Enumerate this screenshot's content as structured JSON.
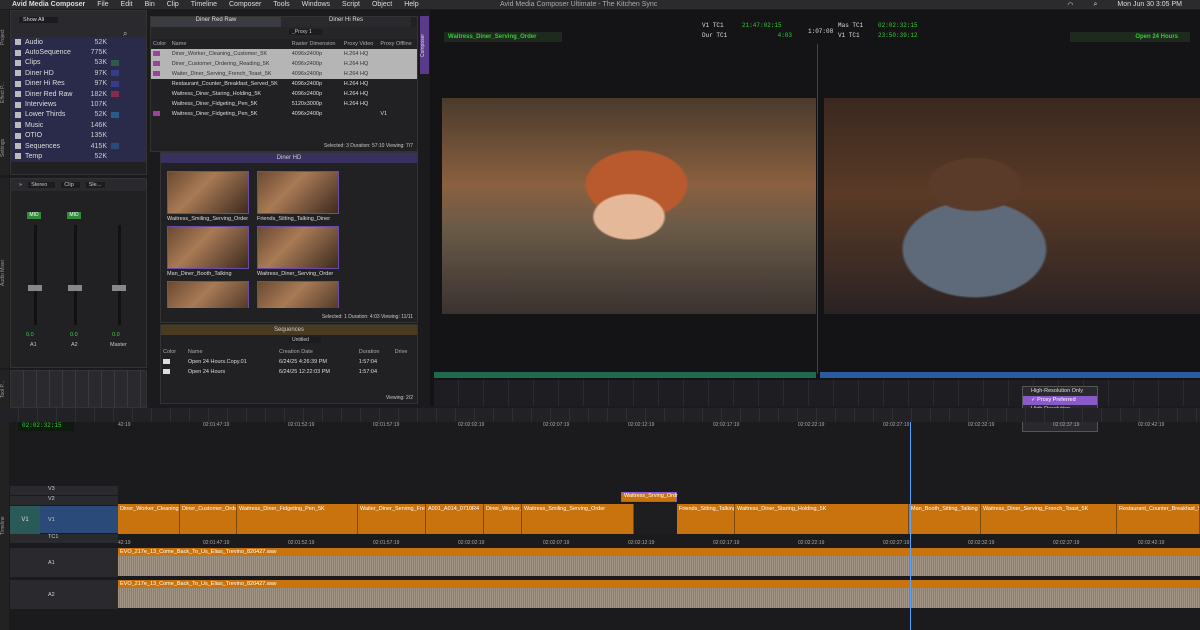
{
  "menubar": {
    "app": "Avid Media Composer",
    "items": [
      "File",
      "Edit",
      "Bin",
      "Clip",
      "Timeline",
      "Composer",
      "Tools",
      "Windows",
      "Script",
      "Object",
      "Help"
    ],
    "window_title": "Avid Media Composer Ultimate - The Kitchen Sync",
    "clock": "Mon Jun 30  3:05 PM"
  },
  "project": {
    "filter": "Show All",
    "bins": [
      {
        "name": "Audio",
        "size": "52K",
        "color": ""
      },
      {
        "name": "AutoSequence",
        "size": "775K",
        "color": ""
      },
      {
        "name": "Clips",
        "size": "53K",
        "color": "#2e5a4a"
      },
      {
        "name": "Diner HD",
        "size": "97K",
        "color": "#3a3a8a"
      },
      {
        "name": "Diner Hi Res",
        "size": "97K",
        "color": "#3a3a8a"
      },
      {
        "name": "Diner Red Raw",
        "size": "182K",
        "color": "#8a2a4a"
      },
      {
        "name": "Interviews",
        "size": "107K",
        "color": ""
      },
      {
        "name": "Lower Thirds",
        "size": "52K",
        "color": "#2a5a8a"
      },
      {
        "name": "Music",
        "size": "146K",
        "color": ""
      },
      {
        "name": "OTIO",
        "size": "135K",
        "color": ""
      },
      {
        "name": "Sequences",
        "size": "415K",
        "color": "#2a4a7a"
      },
      {
        "name": "Temp",
        "size": "52K",
        "color": ""
      }
    ],
    "side_tabs": [
      "Project",
      "Effect P...",
      "Settings"
    ]
  },
  "mixer": {
    "side_tab": "Audio Mixer",
    "selectors": [
      "Stereo",
      "Clip",
      "Sle..."
    ],
    "channels": [
      {
        "name": "A1",
        "mode": "MID",
        "value": "0.0"
      },
      {
        "name": "A2",
        "mode": "MID",
        "value": "0.0"
      },
      {
        "name": "Master",
        "mode": "",
        "value": "0.0"
      }
    ],
    "scale": [
      "+12",
      "+9",
      "+6",
      "+3",
      "0",
      "-3",
      "-6",
      "-9",
      "-12",
      "-15",
      "-20",
      "-30",
      "-40",
      "-50",
      "-60"
    ]
  },
  "tool_palette_tab": "Tool P...",
  "bin_red_raw": {
    "tabs": [
      "Diner Red Raw",
      "Diner Hi Res"
    ],
    "proxy_select": "_Proxy 1",
    "columns": [
      "Color",
      "Name",
      "Raster Dimension",
      "Proxy Video",
      "Proxy Offline"
    ],
    "rows": [
      {
        "name": "Diner_Worker_Cleaning_Customer_5K",
        "raster": "4096x2400p",
        "proxy": "H.264 HQ",
        "offline": "",
        "color": "#a0409a",
        "selected": true
      },
      {
        "name": "Diner_Customer_Ordering_Reading_5K",
        "raster": "4096x2400p",
        "proxy": "H.264 HQ",
        "offline": "",
        "color": "#a0409a",
        "selected": true
      },
      {
        "name": "Waiter_Diner_Serving_French_Toast_5K",
        "raster": "4096x2400p",
        "proxy": "H.264 HQ",
        "offline": "",
        "color": "#a0409a",
        "selected": true
      },
      {
        "name": "Restaurant_Counter_Breakfast_Served_5K",
        "raster": "4096x2400p",
        "proxy": "H.264 HQ",
        "offline": "",
        "color": "",
        "selected": false
      },
      {
        "name": "Waitress_Diner_Staring_Holding_5K",
        "raster": "4096x2400p",
        "proxy": "H.264 HQ",
        "offline": "",
        "color": "",
        "selected": false
      },
      {
        "name": "Waitress_Diner_Fidgeting_Pen_5K",
        "raster": "5120x3000p",
        "proxy": "H.264 HQ",
        "offline": "",
        "color": "",
        "selected": false
      },
      {
        "name": "Waitress_Diner_Fidgeting_Pen_5K",
        "raster": "4096x2400p",
        "proxy": "",
        "offline": "V1",
        "color": "#a0409a",
        "selected": false
      }
    ],
    "status": "Selected: 3  Duration: 57:10   Viewing: 7/7"
  },
  "bin_hd": {
    "title": "Diner HD",
    "items": [
      "Waitress_Smiling_Serving_Order",
      "Friends_Sitting_Talking_Diner",
      "Man_Diner_Booth_Talking",
      "Waitress_Diner_Serving_Order",
      "Man_Booth_Sitting_Talking",
      "Friends_Sitting_Talking_Dir"
    ],
    "status": "Selected: 1  Duration: 4:03   Viewing: 11/11"
  },
  "bin_seq": {
    "title": "Sequences",
    "select": "Untitled",
    "columns": [
      "Color",
      "Name",
      "Creation Date",
      "Duration",
      "Drive"
    ],
    "rows": [
      {
        "name": "Open 24 Hours.Copy.01",
        "date": "6/24/25 4:26:39 PM",
        "duration": "1:57:04"
      },
      {
        "name": "Open 24 Hours",
        "date": "6/24/25 12:22:03 PM",
        "duration": "1:57:04"
      }
    ],
    "status": "Viewing: 2/2"
  },
  "composer": {
    "side_tab": "Composer",
    "source_clip": "Waitress_Diner_Serving_Order",
    "record_seq": "Open 24 Hours",
    "tc": {
      "v1_label": "V1  TC1",
      "v1": "21:47:02:15",
      "dur_label": "Dur TC1",
      "dur": "4:03",
      "center": "1:07:08",
      "mas_label": "Mas TC1",
      "mas": "02:02:32:15",
      "v1r_label": "V1  TC1",
      "v1r": "23:50:39:12"
    },
    "menu_items": [
      "High-Resolution Only",
      "Proxy Preferred",
      "High-Resolution Preferred",
      "What's This?"
    ],
    "menu_checked": "Proxy Preferred"
  },
  "timeline": {
    "side_tab": "Timeline",
    "position_tc": "02:02:32:15",
    "ruler": [
      "42:19",
      "02:01:47:19",
      "02:01:52:19",
      "02:01:57:19",
      "02:02:02:19",
      "02:02:07:19",
      "02:02:12:19",
      "02:02:17:19",
      "02:02:22:19",
      "02:02:27:19",
      "02:02:32:19",
      "02:02:37:19",
      "02:02:42:19"
    ],
    "tracks": {
      "v3": "V3",
      "v2": "V2",
      "v1": "V1",
      "tc1": "TC1",
      "a1": "A1",
      "a2": "A2"
    },
    "v2_clip": "Waitress_Srving_Ordr",
    "v1_clips": [
      "Diner_Worker_Cleaning_",
      "Diner_Customer_Orde",
      "Waitress_Diner_Fidgeting_Pen_5K",
      "Waiter_Diner_Serving_Frenc",
      "A001_A014_0710R4",
      "Diner_Worker_S",
      "Waitress_Smiling_Serving_Order",
      "Friends_Sitting_Talking_I",
      "Waitress_Diner_Staring_Holding_5K",
      "Man_Booth_Sitting_Talking",
      "Waitress_Diner_Serving_French_Toast_5K",
      "Restaurant_Counter_Breakfast_Se"
    ],
    "tc_values": [
      "42:19",
      "02:01:47:19",
      "02:01:52:19",
      "02:01:57:19",
      "02:02:02:19",
      "02:02:07:19",
      "02:02:12:19",
      "02:02:17:19",
      "02:02:22:19",
      "02:02:27:19",
      "02:02:32:19",
      "02:02:37:19",
      "02:02:42:19"
    ],
    "audio_clip": "EVO_217e_13_Come_Back_To_Us_Elias_Trevino_820427.wav"
  }
}
